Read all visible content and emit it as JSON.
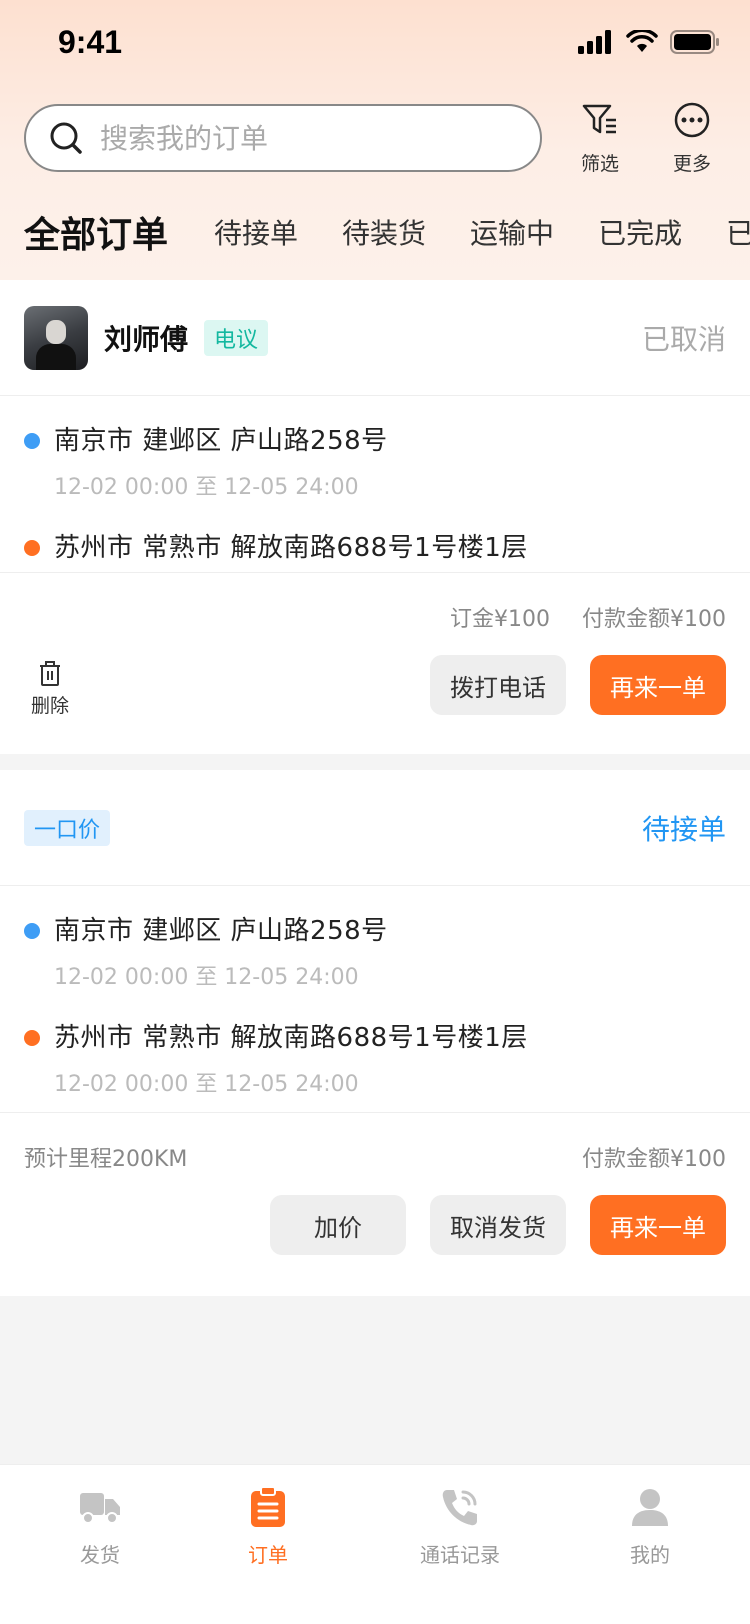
{
  "status_bar": {
    "time": "9:41"
  },
  "search": {
    "placeholder": "搜索我的订单",
    "value": ""
  },
  "header_actions": {
    "filter_label": "筛选",
    "more_label": "更多"
  },
  "tabs": [
    {
      "label": "全部订单",
      "active": true
    },
    {
      "label": "待接单"
    },
    {
      "label": "待装货"
    },
    {
      "label": "运输中"
    },
    {
      "label": "已完成"
    },
    {
      "label": "已"
    }
  ],
  "orders": [
    {
      "driver_name": "刘师傅",
      "price_tag": "电议",
      "status": "已取消",
      "status_color": "#aaaaaa",
      "pickup": {
        "address": "南京市 建邺区 庐山路258号",
        "time": "12-02 00:00 至 12-05 24:00"
      },
      "dropoff": {
        "address": "苏州市 常熟市 解放南路688号1号楼1层"
      },
      "deposit": "订金¥100",
      "payment": "付款金额¥100",
      "delete_label": "删除",
      "buttons": {
        "call": "拨打电话",
        "reorder": "再来一单"
      }
    },
    {
      "price_tag": "一口价",
      "status": "待接单",
      "status_color": "#2196f3",
      "pickup": {
        "address": "南京市 建邺区 庐山路258号",
        "time": "12-02 00:00 至 12-05 24:00"
      },
      "dropoff": {
        "address": "苏州市 常熟市 解放南路688号1号楼1层",
        "time": "12-02 00:00 至 12-05 24:00"
      },
      "mileage": "预计里程200KM",
      "payment": "付款金额¥100",
      "buttons": {
        "raise_price": "加价",
        "cancel": "取消发货",
        "reorder": "再来一单"
      }
    }
  ],
  "tabbar": [
    {
      "label": "发货",
      "icon": "truck-icon"
    },
    {
      "label": "订单",
      "icon": "clipboard-icon",
      "active": true
    },
    {
      "label": "通话记录",
      "icon": "phone-icon"
    },
    {
      "label": "我的",
      "icon": "user-icon"
    }
  ],
  "colors": {
    "accent": "#ff6f22",
    "blue": "#2196f3",
    "teal": "#14b8a0"
  }
}
